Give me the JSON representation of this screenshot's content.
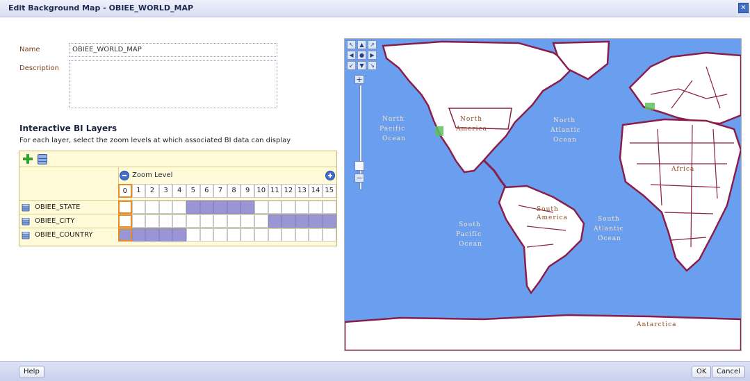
{
  "dialog": {
    "title": "Edit Background Map - OBIEE_WORLD_MAP",
    "close_glyph": "✕"
  },
  "form": {
    "name_label": "Name",
    "name_value": "OBIEE_WORLD_MAP",
    "description_label": "Description",
    "description_value": ""
  },
  "layers_section": {
    "title": "Interactive BI Layers",
    "description": "For each layer, select the zoom levels at which associated BI data can display",
    "zoom_label": "Zoom Level",
    "zoom_levels": [
      "0",
      "1",
      "2",
      "3",
      "4",
      "5",
      "6",
      "7",
      "8",
      "9",
      "10",
      "11",
      "12",
      "13",
      "14",
      "15"
    ],
    "selected_level": 0,
    "layers": [
      {
        "name": "OBIEE_STATE",
        "active_levels": [
          5,
          6,
          7,
          8,
          9
        ]
      },
      {
        "name": "OBIEE_CITY",
        "active_levels": [
          11,
          12,
          13,
          14,
          15
        ]
      },
      {
        "name": "OBIEE_COUNTRY",
        "active_levels": [
          0,
          1,
          2,
          3,
          4
        ]
      }
    ]
  },
  "map": {
    "labels": {
      "north_america": "North America",
      "south_america": "South America",
      "africa": "Africa",
      "antarctica": "Antarctica",
      "north_pacific": "North Pacific Ocean",
      "north_atlantic": "North Atlantic Ocean",
      "south_pacific": "South Pacific Ocean",
      "south_atlantic": "South Atlantic Ocean"
    },
    "nav_glyphs": [
      "↖",
      "▲",
      "↗",
      "◀",
      "●",
      "▶",
      "↙",
      "▼",
      "↘"
    ],
    "colors": {
      "ocean": "#6a9ff0",
      "land": "#ffffff",
      "border": "#8a1e4a"
    }
  },
  "footer": {
    "help_label": "Help",
    "ok_label": "OK",
    "cancel_label": "Cancel"
  }
}
